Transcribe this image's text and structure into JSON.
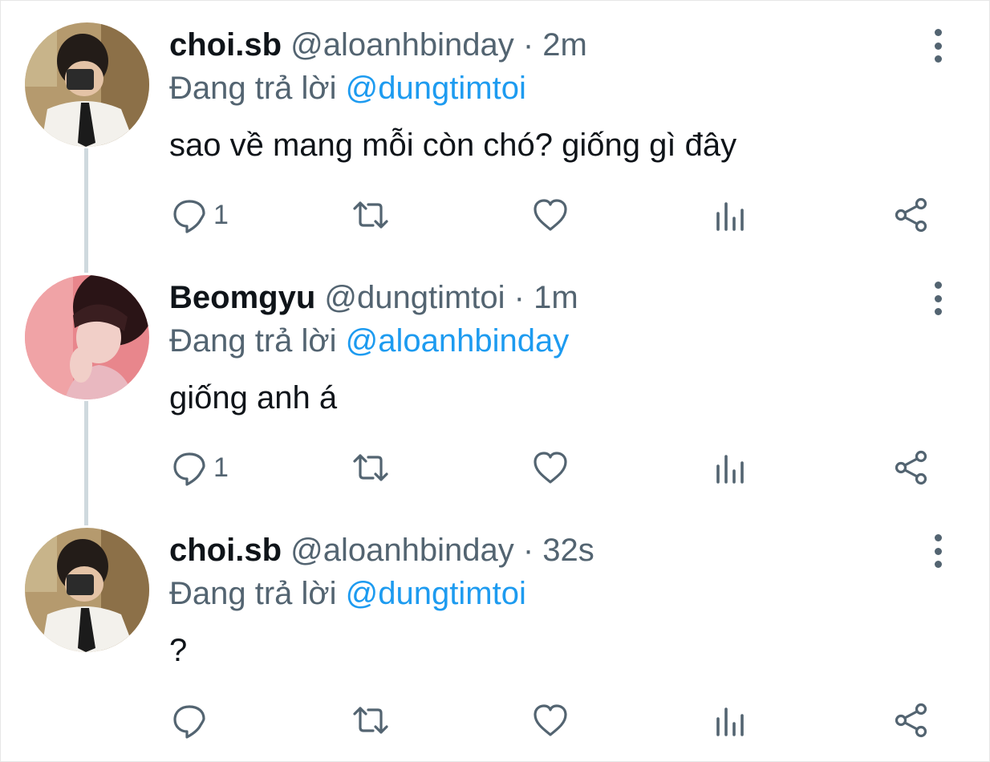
{
  "colors": {
    "text": "#0f1419",
    "secondary": "#536471",
    "mention": "#1d9bf0",
    "thread_line": "#cfd9de"
  },
  "tweets": [
    {
      "avatar": "avatar-selfie-boy",
      "name": "choi.sb",
      "handle": "@aloanhbinday",
      "time": "· 2m",
      "reply_prefix": "Đang trả lời",
      "reply_to": "@dungtimtoi",
      "text": "sao về mang mỗi còn chó? giống gì đây",
      "reply_count": "1"
    },
    {
      "avatar": "avatar-pink-portrait",
      "name": "Beomgyu",
      "handle": "@dungtimtoi",
      "time": "· 1m",
      "reply_prefix": "Đang trả lời",
      "reply_to": "@aloanhbinday",
      "text": "giống anh á",
      "reply_count": "1"
    },
    {
      "avatar": "avatar-selfie-boy",
      "name": "choi.sb",
      "handle": "@aloanhbinday",
      "time": "· 32s",
      "reply_prefix": "Đang trả lời",
      "reply_to": "@dungtimtoi",
      "text": "?",
      "reply_count": ""
    }
  ]
}
